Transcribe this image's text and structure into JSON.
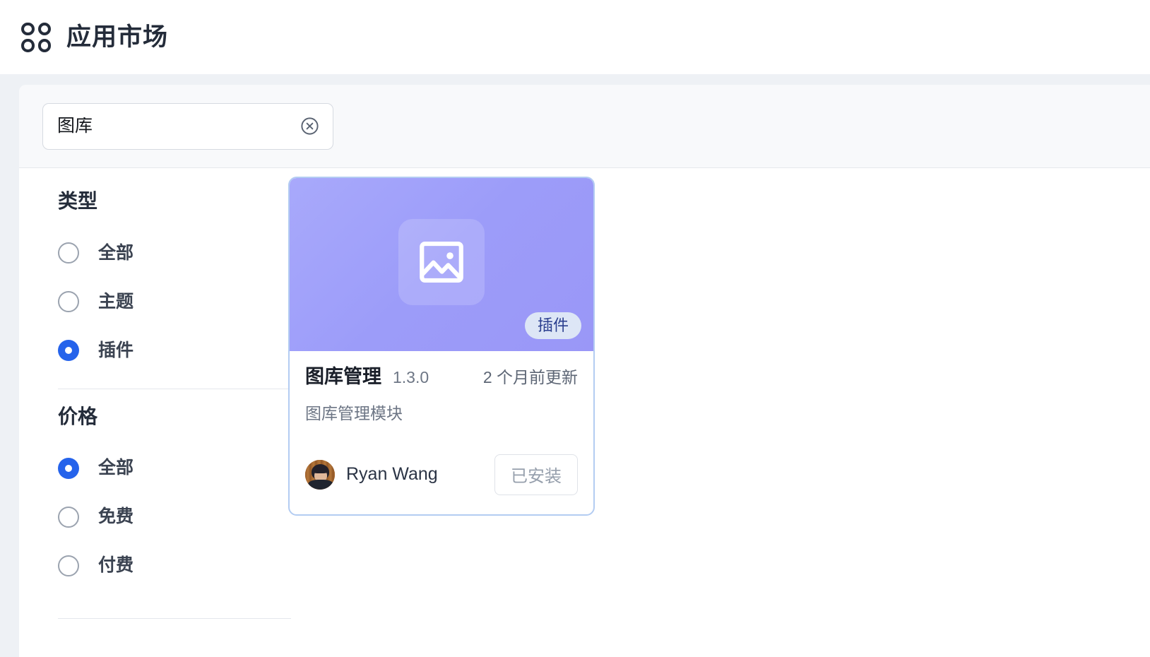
{
  "header": {
    "icon": "apps-grid-icon",
    "title": "应用市场"
  },
  "search": {
    "value": "图库",
    "placeholder": "",
    "clear_icon": "circle-x-icon"
  },
  "filters": [
    {
      "title": "类型",
      "name": "type",
      "options": [
        {
          "label": "全部",
          "selected": false
        },
        {
          "label": "主题",
          "selected": false
        },
        {
          "label": "插件",
          "selected": true
        }
      ]
    },
    {
      "title": "价格",
      "name": "price",
      "options": [
        {
          "label": "全部",
          "selected": true
        },
        {
          "label": "免费",
          "selected": false
        },
        {
          "label": "付费",
          "selected": false
        }
      ]
    }
  ],
  "cards": [
    {
      "banner_icon": "image-placeholder-icon",
      "badge": "插件",
      "name": "图库管理",
      "version": "1.3.0",
      "updated": "2 个月前更新",
      "description": "图库管理模块",
      "author": "Ryan Wang",
      "action_label": "已安装",
      "action_disabled": true
    }
  ],
  "colors": {
    "accent": "#2563eb",
    "card_border": "#b3ccf2",
    "banner_start": "#a8a9fb",
    "banner_end": "#9a97f7",
    "badge_bg": "#dde6f6",
    "badge_text": "#2b3f8f",
    "page_bg": "#eef1f5",
    "strip_bg": "#f8f9fb"
  }
}
